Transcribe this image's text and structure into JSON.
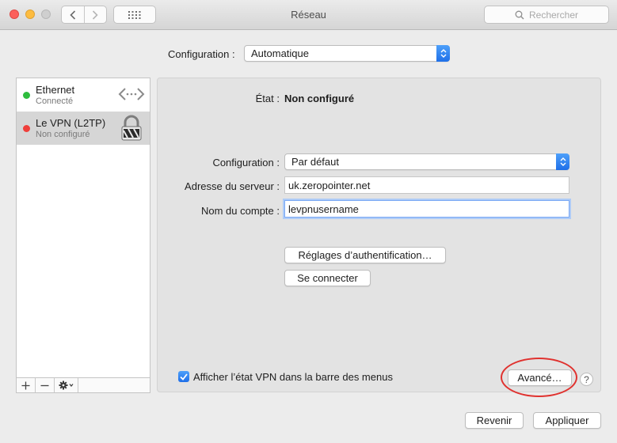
{
  "window": {
    "title": "Réseau"
  },
  "toolbar": {
    "search_placeholder": "Rechercher"
  },
  "top_config": {
    "label": "Configuration :",
    "value": "Automatique"
  },
  "services": [
    {
      "name": "Ethernet",
      "status": "Connecté",
      "status_color": "#2ebd3e",
      "icon": "ethernet-arrows-icon"
    },
    {
      "name": "Le VPN (L2TP)",
      "status": "Non configuré",
      "status_color": "#ef3f3b",
      "icon": "vpn-lock-icon",
      "selected": true
    }
  ],
  "detail": {
    "state_label": "État :",
    "state_value": "Non configuré",
    "configuration_label": "Configuration :",
    "configuration_value": "Par défaut",
    "server_label": "Adresse du serveur :",
    "server_value": "uk.zeropointer.net",
    "account_label": "Nom du compte :",
    "account_value": "levpnusername",
    "auth_button": "Réglages d’authentification…",
    "connect_button": "Se connecter",
    "show_vpn_label": "Afficher l’état VPN dans la barre des menus",
    "show_vpn_checked": true,
    "advanced_button": "Avancé…",
    "help_glyph": "?"
  },
  "footer": {
    "revert_button": "Revenir",
    "apply_button": "Appliquer"
  },
  "colors": {
    "accent": "#1f6fe8",
    "highlight_circle": "#e0322f"
  }
}
